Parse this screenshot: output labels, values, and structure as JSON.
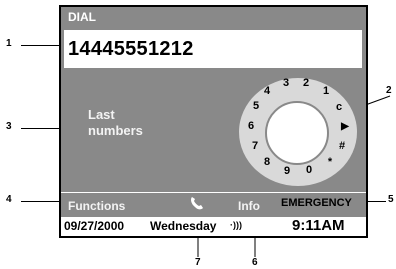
{
  "screen": {
    "title": "DIAL",
    "number": "14445551212",
    "last_numbers_line1": "Last",
    "last_numbers_line2": "numbers"
  },
  "dial": {
    "keys": [
      "1",
      "2",
      "3",
      "4",
      "5",
      "6",
      "7",
      "8",
      "9",
      "0",
      "*",
      "#",
      "c",
      "▶"
    ]
  },
  "softkeys": {
    "functions": "Functions",
    "info": "Info",
    "emergency": "EMERGENCY",
    "phone_icon": "phone-handset-icon"
  },
  "status_bar": {
    "date": "09/27/2000",
    "day": "Wednesday",
    "signal_glyph": "·)))",
    "time": "9:11AM"
  },
  "callouts": {
    "c1": "1",
    "c2": "2",
    "c3": "3",
    "c4": "4",
    "c5": "5",
    "c6": "6",
    "c7": "7"
  },
  "colors": {
    "screen_bg": "#898989",
    "light_text": "#f3f3f3"
  }
}
